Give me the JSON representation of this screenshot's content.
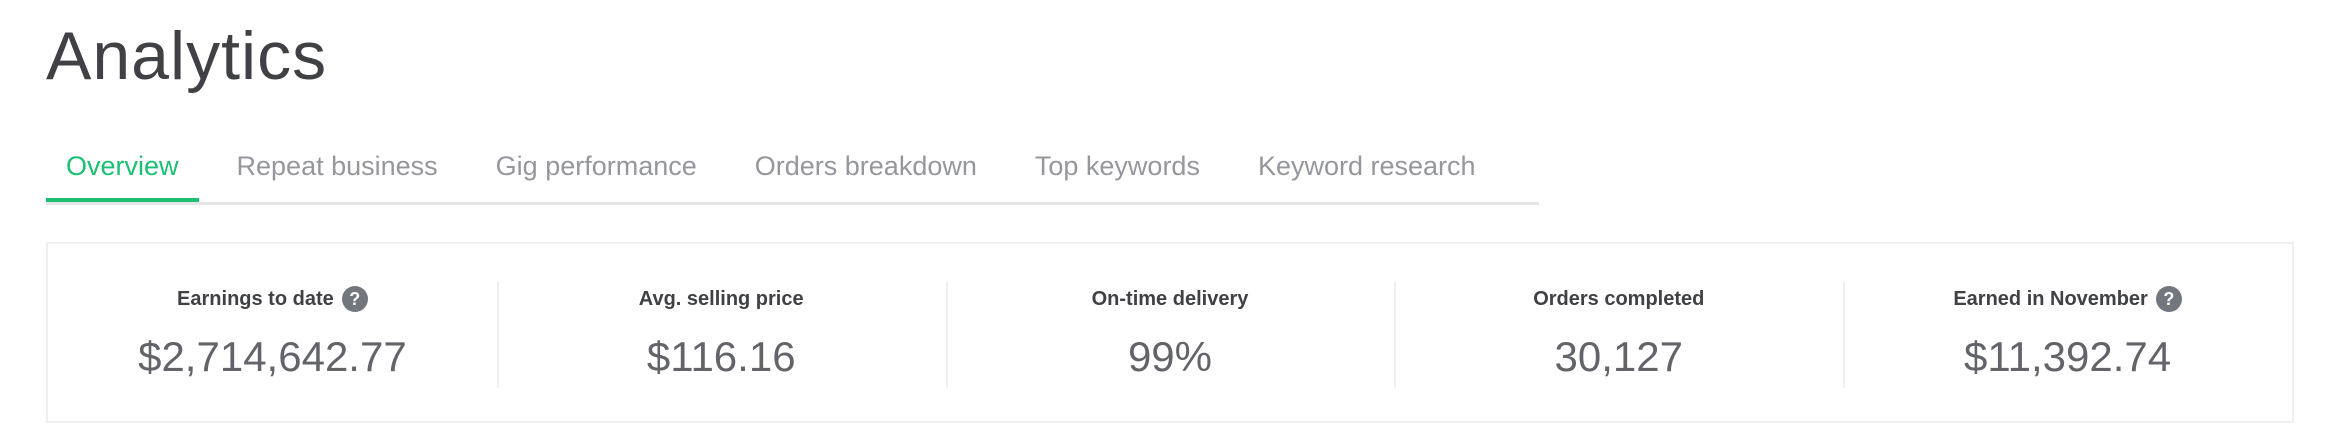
{
  "page": {
    "title": "Analytics"
  },
  "tabs": [
    {
      "label": "Overview",
      "active": true
    },
    {
      "label": "Repeat business",
      "active": false
    },
    {
      "label": "Gig performance",
      "active": false
    },
    {
      "label": "Orders breakdown",
      "active": false
    },
    {
      "label": "Top keywords",
      "active": false
    },
    {
      "label": "Keyword research",
      "active": false
    }
  ],
  "stats": [
    {
      "label": "Earnings to date",
      "value": "$2,714,642.77",
      "help": true,
      "help_icon": "question-icon"
    },
    {
      "label": "Avg. selling price",
      "value": "$116.16",
      "help": false
    },
    {
      "label": "On-time delivery",
      "value": "99%",
      "help": false
    },
    {
      "label": "Orders completed",
      "value": "30,127",
      "help": false
    },
    {
      "label": "Earned in November",
      "value": "$11,392.74",
      "help": true,
      "help_icon": "question-icon"
    }
  ],
  "colors": {
    "accent": "#1dbf73",
    "tab_inactive": "#95979d",
    "text": "#404145",
    "value": "#62646a",
    "border": "#efeff0",
    "help_icon_bg": "#74767e"
  }
}
